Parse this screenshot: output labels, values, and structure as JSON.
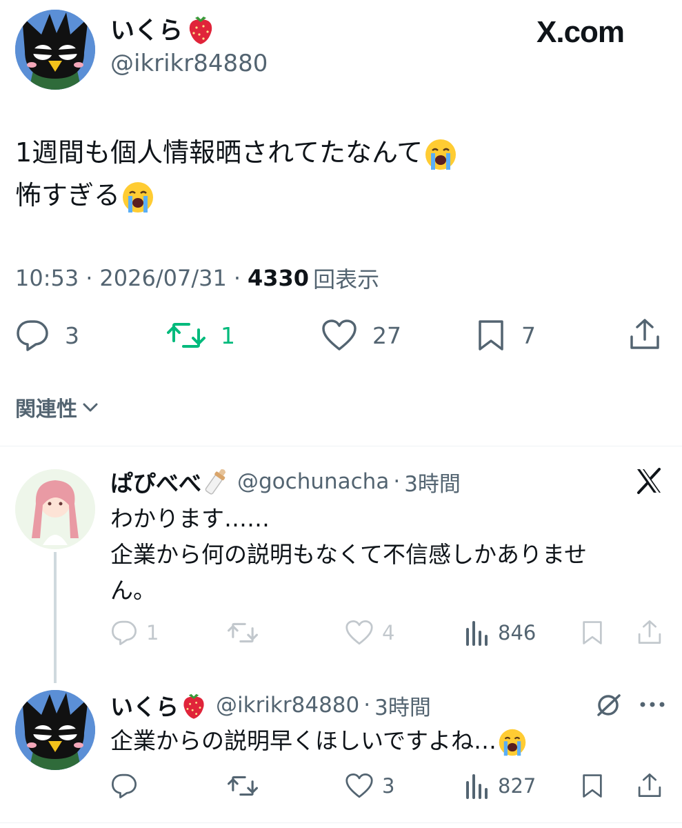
{
  "watermark": "X.com",
  "post": {
    "author_name": "いくら",
    "author_handle": "@ikrikr84880",
    "text_line1": "1週間も個人情報晒されてたなんて",
    "text_line2": "怖すぎる",
    "time": "10:53",
    "date": "2026/07/31",
    "views_count": "4330",
    "views_label": "回表示",
    "replies": "3",
    "reposts": "1",
    "likes": "27",
    "bookmarks": "7"
  },
  "sort_label": "関連性",
  "reply1": {
    "author_name": "ぱぴべべ",
    "author_handle": "@gochunacha",
    "time": "3時間",
    "text_line1": "わかります……",
    "text_line2": "企業から何の説明もなくて不信感しかありませ",
    "text_line3": "ん。",
    "replies": "1",
    "likes": "4",
    "views": "846"
  },
  "reply2": {
    "author_name": "いくら",
    "author_handle": "@ikrikr84880",
    "time": "3時間",
    "text": "企業からの説明早くほしいですよね…",
    "likes": "3",
    "views": "827"
  },
  "colors": {
    "text": "#0f1419",
    "secondary": "#536471",
    "repost_active": "#00ba7c"
  }
}
